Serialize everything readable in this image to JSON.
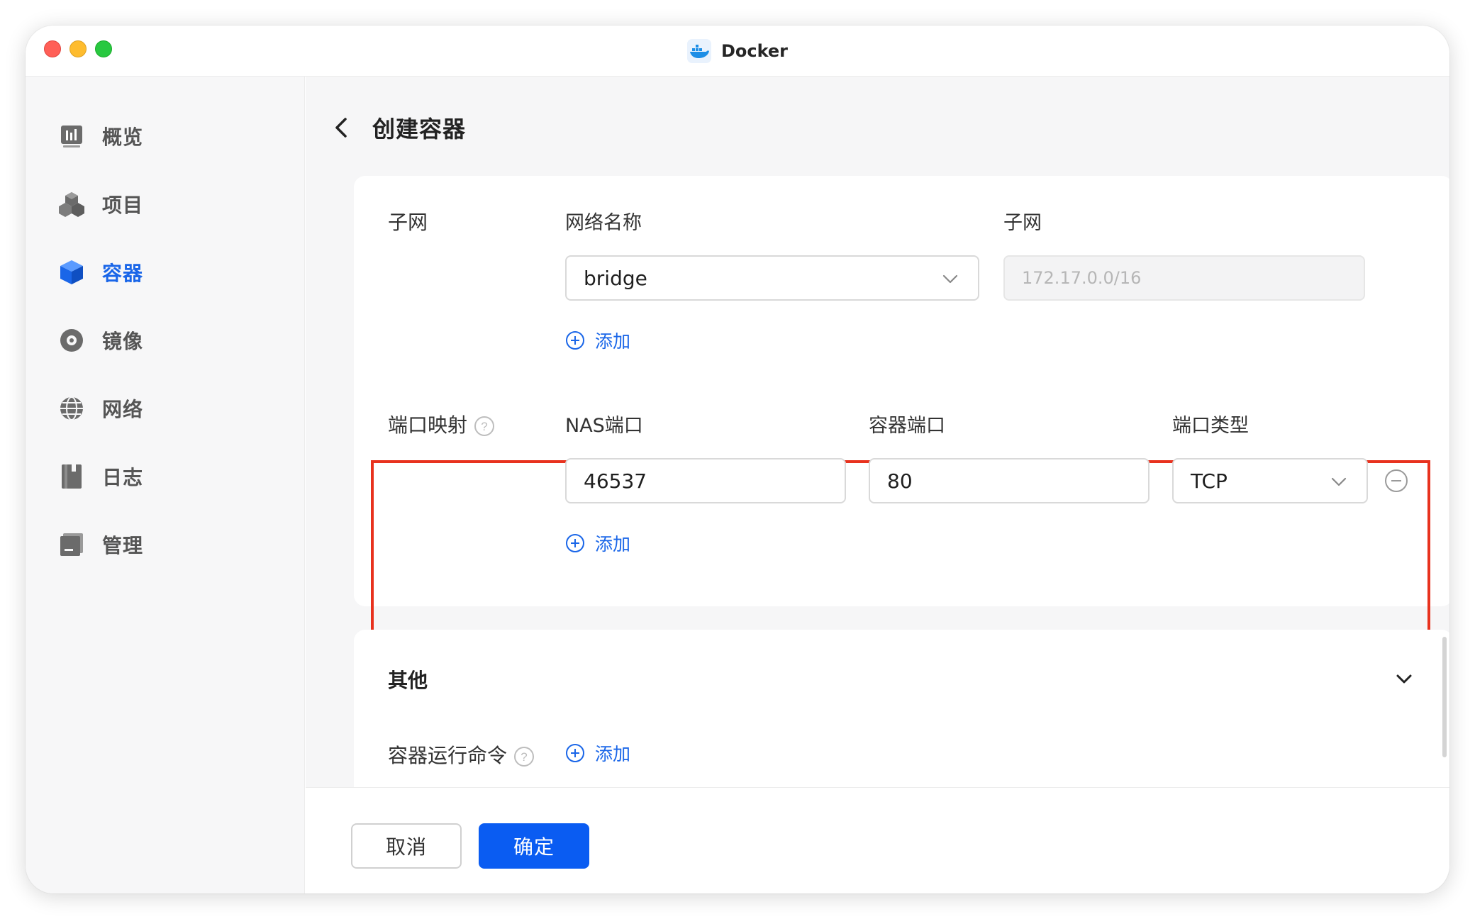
{
  "window": {
    "title": "Docker"
  },
  "sidebar": {
    "items": [
      {
        "label": "概览",
        "icon": "chart-icon",
        "active": false
      },
      {
        "label": "项目",
        "icon": "cubes-icon",
        "active": false
      },
      {
        "label": "容器",
        "icon": "container-icon",
        "active": true
      },
      {
        "label": "镜像",
        "icon": "disc-icon",
        "active": false
      },
      {
        "label": "网络",
        "icon": "globe-icon",
        "active": false
      },
      {
        "label": "日志",
        "icon": "log-book-icon",
        "active": false
      },
      {
        "label": "管理",
        "icon": "manage-icon",
        "active": false
      }
    ],
    "active_color": "#1a66e8"
  },
  "header": {
    "title": "创建容器"
  },
  "network": {
    "row_label": "子网",
    "col_network_name": "网络名称",
    "col_subnet": "子网",
    "network_value": "bridge",
    "subnet_value": "172.17.0.0/16",
    "add_label": "添加"
  },
  "port_mapping": {
    "row_label": "端口映射",
    "col_nas_port": "NAS端口",
    "col_container_port": "容器端口",
    "col_port_type": "端口类型",
    "nas_port_value": "46537",
    "container_port_value": "80",
    "port_type_value": "TCP",
    "add_label": "添加",
    "highlight_color": "#e8321e"
  },
  "other": {
    "section_title": "其他",
    "cmd_label": "容器运行命令",
    "add_label": "添加"
  },
  "footer": {
    "cancel_label": "取消",
    "confirm_label": "确定",
    "primary_color": "#0a5cf2"
  }
}
